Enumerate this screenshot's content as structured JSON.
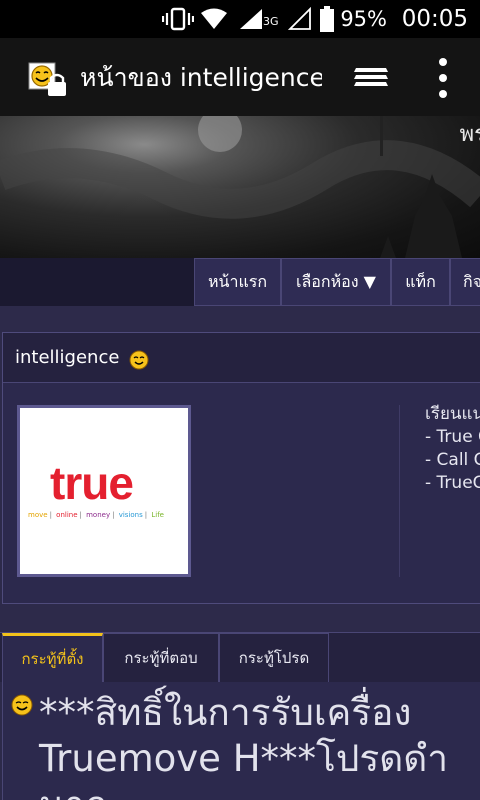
{
  "status_bar": {
    "network_label": "3G",
    "battery_percent": "95%",
    "time": "00:05"
  },
  "app_bar": {
    "title": "หน้าของ intelligence",
    "favicon": "emoticon-lock-icon"
  },
  "banner": {
    "text": "พร"
  },
  "nav": {
    "tabs": [
      "หน้าแรก",
      "เลือกห้อง ▼",
      "แท็ก",
      "กิจ"
    ]
  },
  "profile": {
    "name": "intelligence",
    "logo_word": "true",
    "logo_tagline": [
      "move",
      "online",
      "money",
      "visions",
      "Life"
    ],
    "description_lines": [
      "เรียนแน",
      "- True C",
      "- Call C",
      "- TrueC"
    ]
  },
  "post_tabs": {
    "items": [
      "กระทู้ที่ตั้ง",
      "กระทู้ที่ตอบ",
      "กระทู้โปรด"
    ],
    "active_index": 0
  },
  "post": {
    "title_lines": [
      "***สิทธิ์ในการรับเครื่อง",
      "Truemove H***โปรดดำ",
      "นาก"
    ]
  },
  "colors": {
    "accent": "#f3c21b",
    "true_red": "#e4202f",
    "page_bg": "#2d2a4a"
  }
}
